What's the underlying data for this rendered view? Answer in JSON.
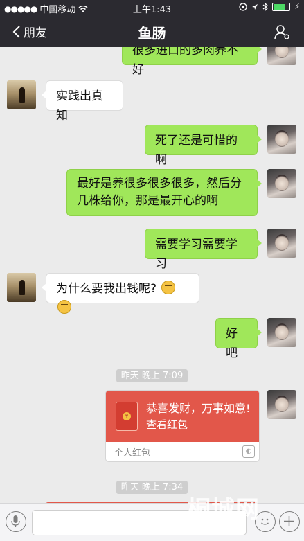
{
  "status_bar": {
    "carrier": "中国移动",
    "time": "上午1:43"
  },
  "nav": {
    "back_label": "朋友",
    "title": "鱼肠"
  },
  "messages": [
    {
      "from": "me",
      "text": "很多进口的多肉养不好"
    },
    {
      "from": "other",
      "text": "实践出真知"
    },
    {
      "from": "me",
      "text": "死了还是可惜的啊"
    },
    {
      "from": "me",
      "text": "最好是养很多很多很多，然后分几株给你，那是最开心的啊"
    },
    {
      "from": "me",
      "text": "需要学习需要学习"
    },
    {
      "from": "other",
      "text": "为什么要我出钱呢?"
    },
    {
      "from": "me",
      "text": "好吧"
    }
  ],
  "timestamps": [
    "昨天 晚上 7:09",
    "昨天 晚上 7:34"
  ],
  "red_packet": {
    "greeting": "恭喜发财，万事如意!",
    "action": "查看红包",
    "footer": "个人红包",
    "coin_symbol": "¥"
  },
  "watermark": {
    "text": "桐城网"
  },
  "colors": {
    "my_bubble": "#a0e75a",
    "red_packet": "#e2574a",
    "nav_bg": "#2b2a30"
  }
}
